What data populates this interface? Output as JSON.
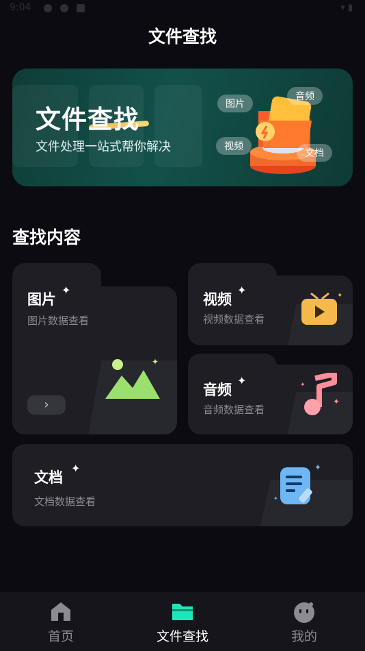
{
  "status_bar": {
    "time": "9:04"
  },
  "page_title": "文件查找",
  "banner": {
    "title": "文件查找",
    "subtitle": "文件处理一站式帮你解决",
    "tags": {
      "image": "图片",
      "audio": "音频",
      "video": "视频",
      "doc": "文档"
    }
  },
  "section_title": "查找内容",
  "cards": {
    "image": {
      "title": "图片",
      "subtitle": "图片数据查看",
      "icon": "image-icon"
    },
    "video": {
      "title": "视频",
      "subtitle": "视频数据查看",
      "icon": "video-icon"
    },
    "audio": {
      "title": "音频",
      "subtitle": "音频数据查看",
      "icon": "music-icon"
    },
    "doc": {
      "title": "文档",
      "subtitle": "文档数据查看",
      "icon": "document-icon"
    }
  },
  "bottom_nav": {
    "items": [
      {
        "label": "首页",
        "icon": "home-icon",
        "active": false
      },
      {
        "label": "文件查找",
        "icon": "folder-icon",
        "active": true
      },
      {
        "label": "我的",
        "icon": "profile-icon",
        "active": false
      }
    ]
  },
  "colors": {
    "accent": "#1ee6b9",
    "background": "#0b0b11",
    "card": "#1e1e24",
    "inactive": "#8b8b94"
  }
}
